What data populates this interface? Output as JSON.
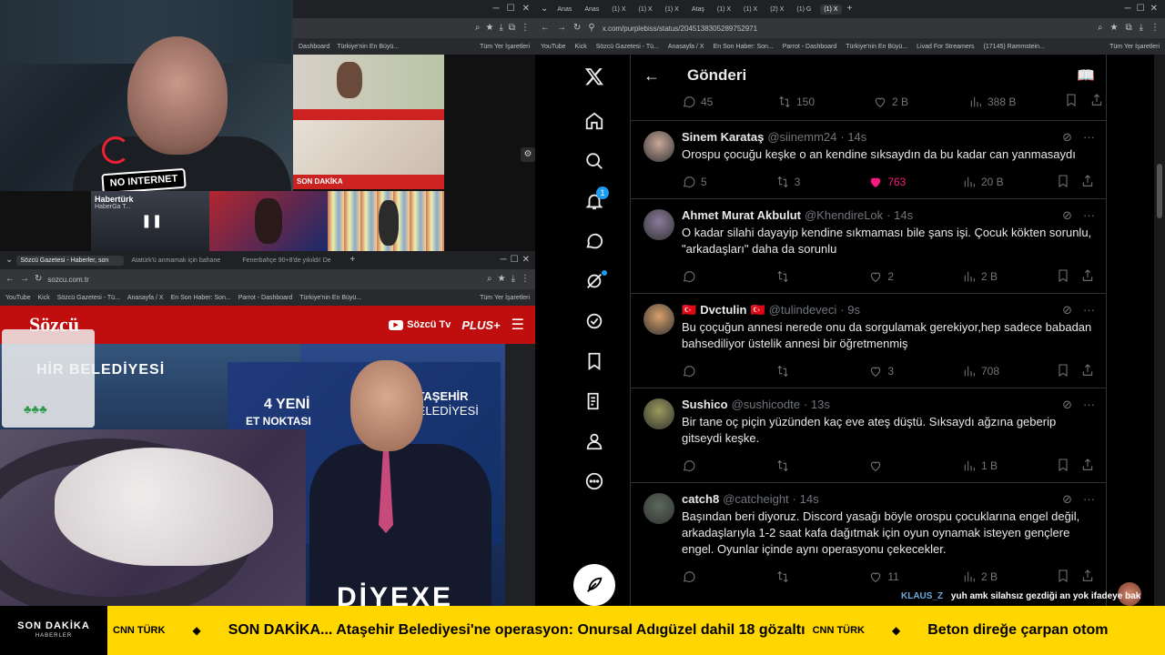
{
  "cam": {
    "logo_text": "NO INTERNET"
  },
  "top_left_browser": {
    "bookmark_text_1": "Dashboard",
    "bookmark_text_2": "Türkiye'nin En Büyü...",
    "bookmark_all": "Tüm Yer İşaretleri"
  },
  "tv": {
    "news_badge": "SON DAKİKA",
    "haberturk": "Habertürk",
    "haberturk_sub": "HaberGa T..."
  },
  "sozcu_browser": {
    "tabs": [
      "Sözcü Gazetesi - Haberler, son",
      "Atatürk'ü anmamak için bahane",
      "Fenerbahçe 90+8'de yıkıldı! De"
    ],
    "url": "sozcu.com.tr",
    "bookmarks": [
      "YouTube",
      "Kick",
      "Sözcü Gazetesi - Tü...",
      "Anasayfa / X",
      "En Son Haber: Son...",
      "Parrot - Dashboard",
      "Türkiye'nin En Büyü..."
    ],
    "bookmark_all": "Tüm Yer İşaretleri",
    "logo": "Sözcü",
    "sozcu_tv": "Sözcü Tv",
    "plus": "PLUS+",
    "building_text": "HİR BELEDİYESİ",
    "billboard_line1": "4 YENİ",
    "billboard_line2": "ET NOKTASI",
    "billboard_brand1": "ATAŞEHİR",
    "billboard_brand2": "BELEDİYESİ",
    "bottom_text": "DİYEXE"
  },
  "x_browser": {
    "tabs": [
      "Anas",
      "Anas",
      "(1) X",
      "(1) X",
      "(1) X",
      "Ataş",
      "(1) X",
      "(1) X",
      "(2) X",
      "(1) G",
      "(1) X"
    ],
    "url": "x.com/purplebiss/status/2045138305289752971",
    "bookmarks": [
      "YouTube",
      "Kick",
      "Sözcü Gazetesi - Tü...",
      "Anasayfa / X",
      "En Son Haber: Son...",
      "Parrot - Dashboard",
      "Türkiye'nin En Büyü...",
      "Livad For Streamers",
      "(17145) Rammstein...",
      "Tüm Yer İşaretleri"
    ],
    "header_title": "Gönderi",
    "notification_count": "1",
    "top_actions": {
      "replies": "45",
      "reposts": "150",
      "likes": "2 B",
      "views": "388 B"
    },
    "tweets": [
      {
        "name": "Sinem Karataş",
        "handle": "@siinemm24",
        "time": "· 14s",
        "text": "Orospu çocuğu keşke o an kendine sıksaydın da bu kadar can yanmasaydı",
        "replies": "5",
        "reposts": "3",
        "likes": "763",
        "views": "20 B",
        "avatar_color": "#c9a89a"
      },
      {
        "name": "Ahmet Murat Akbulut",
        "handle": "@KhendireLok",
        "time": "· 14s",
        "text": "O kadar silahi dayayip kendine sıkmaması bile şans işi. Çocuk kökten sorunlu, \"arkadaşları\" daha da sorunlu",
        "replies": "",
        "reposts": "",
        "likes": "2",
        "views": "2 B",
        "avatar_color": "#8a7a9a"
      },
      {
        "name": "Dvctulin",
        "handle": "@tulindeveci",
        "time": "· 9s",
        "flag": "🇹🇷",
        "text": "Bu çoçuğun annesi nerede onu da sorgulamak gerekiyor,hep sadece babadan bahsediliyor üstelik annesi bir öğretmenmiş",
        "replies": "",
        "reposts": "",
        "likes": "3",
        "views": "708",
        "avatar_color": "#d8a06a"
      },
      {
        "name": "Sushico",
        "handle": "@sushicodte",
        "time": "· 13s",
        "text": "Bir tane oç piçin yüzünden kaç eve ateş düştü. Sıksaydı ağzına geberip gitseydi keşke.",
        "replies": "",
        "reposts": "",
        "likes": "",
        "views": "1 B",
        "avatar_color": "#9a9a5a"
      },
      {
        "name": "catch8",
        "handle": "@catcheight",
        "time": "· 14s",
        "text": "Başından beri diyoruz. Discord yasağı böyle orospu çocuklarına engel değil, arkadaşlarıyla 1-2 saat kafa dağıtmak için oyun oynamak isteyen gençlere engel. Oyunlar içinde aynı operasyonu çekecekler.",
        "replies": "",
        "reposts": "",
        "likes": "11",
        "views": "2 B",
        "avatar_color": "#5a6a5a"
      }
    ]
  },
  "chat": {
    "user": "KLAUS_Z",
    "message": "yuh amk silahsız gezdiği an yok ifadeye bak"
  },
  "ticker": {
    "label_main": "SON DAKİKA",
    "label_sub": "HABERLER",
    "source_1": "CNN TÜRK",
    "headline_1": "SON DAKİKA... Ataşehir Belediyesi'ne operasyon: Onursal Adıgüzel dahil 18 gözaltı",
    "source_2": "CNN TÜRK",
    "headline_2": "Beton direğe çarpan otom",
    "diamond": "◆"
  }
}
